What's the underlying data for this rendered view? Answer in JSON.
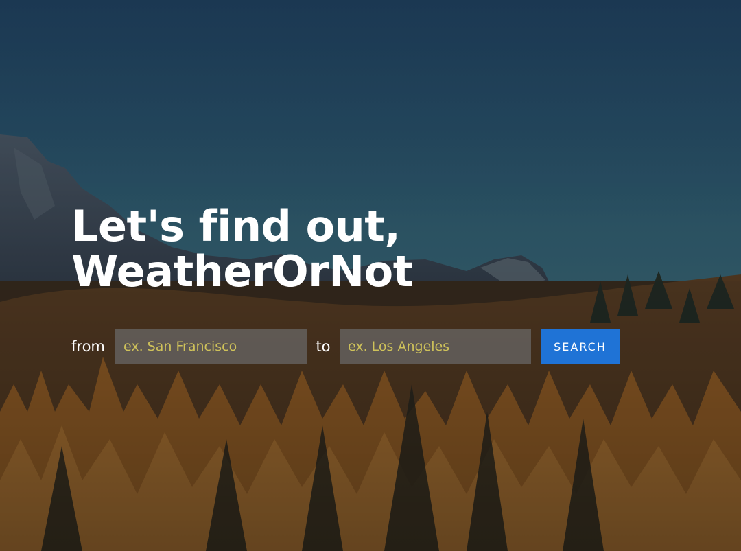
{
  "hero": {
    "headline_line1": "Let's find out,",
    "headline_line2": "WeatherOrNot"
  },
  "search": {
    "from_label": "from",
    "from_placeholder": "ex. San Francisco",
    "from_value": "",
    "to_label": "to",
    "to_placeholder": "ex. Los Angeles",
    "to_value": "",
    "button_label": "SEARCH"
  },
  "colors": {
    "sky": "#1d3446",
    "foliage": "#c0762a",
    "button": "#1f73d6",
    "placeholder": "#cfc25a",
    "input_bg": "#767c82"
  }
}
